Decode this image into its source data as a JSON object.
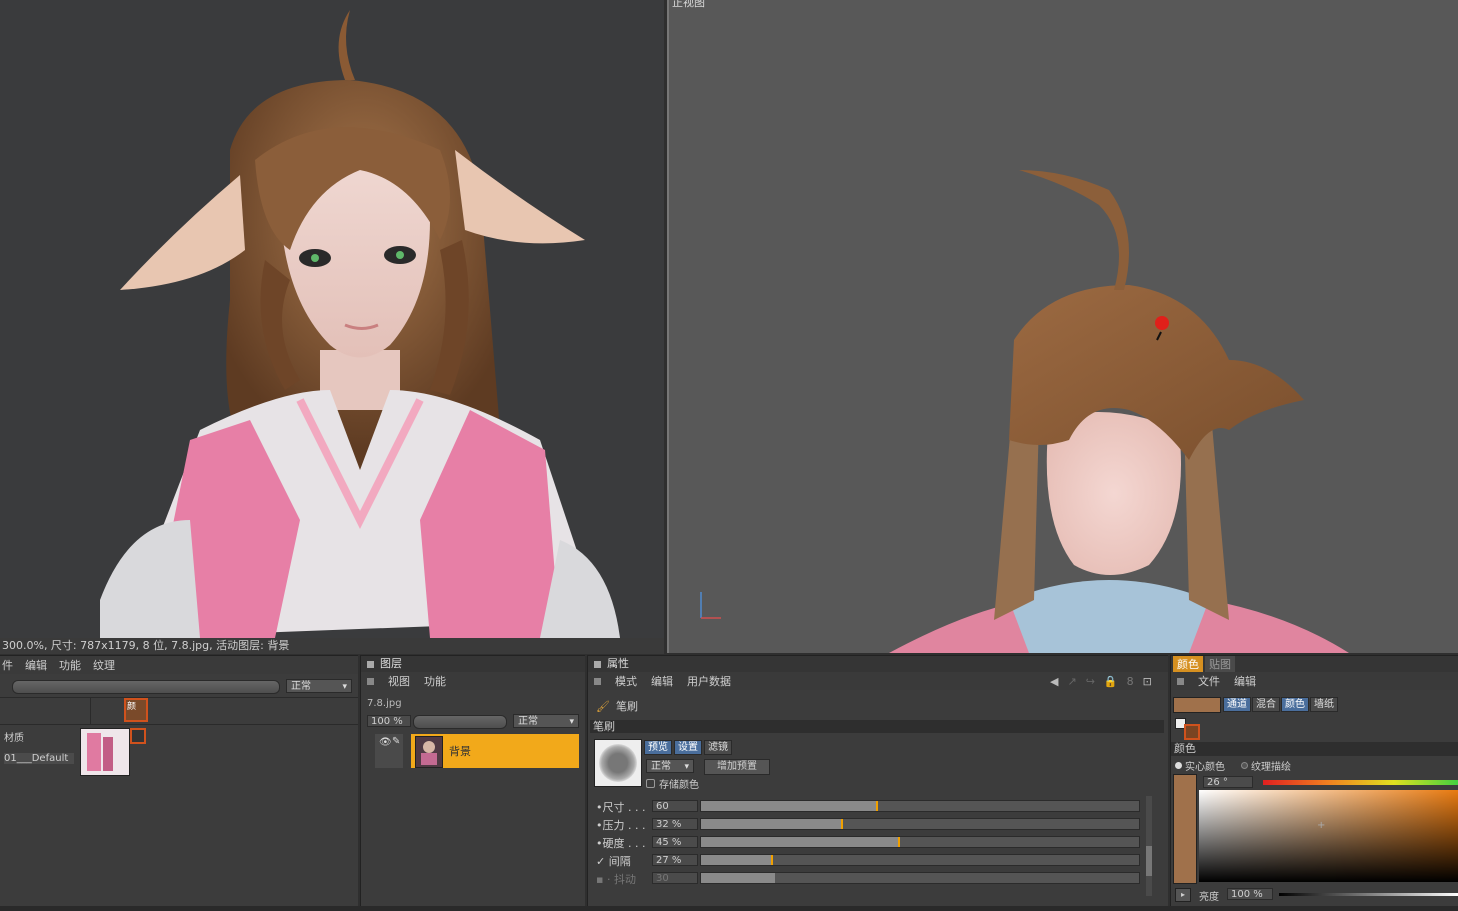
{
  "texture_view": {
    "status": "300.0%, 尺寸: 787x1179, 8 位, 7.8.jpg, 活动图层: 背景"
  },
  "model_view": {
    "title": "正视图"
  },
  "materials_panel": {
    "menu": [
      "件",
      "编辑",
      "功能",
      "纹理"
    ],
    "mode_dropdown": "正常",
    "column_label": "材质",
    "material_name": "01___Default",
    "color_channel_label": "颜"
  },
  "layers_panel": {
    "title": "图层",
    "menu": [
      "视图",
      "功能"
    ],
    "file_name": "7.8.jpg",
    "opacity": "100 %",
    "blend_mode": "正常",
    "layer_name": "背景"
  },
  "attributes_panel": {
    "title": "属性",
    "menu": [
      "模式",
      "编辑",
      "用户数据"
    ],
    "tool_name": "笔刷",
    "section_label": "笔刷",
    "preview_tabs": [
      "预览",
      "设置",
      "滤镜"
    ],
    "blend_mode": "正常",
    "add_preset_button": "增加预置",
    "save_color_label": "存储颜色",
    "params": [
      {
        "label": "尺寸 . . .",
        "value": "60",
        "fraction": 0.4,
        "dot": true,
        "enabled": true
      },
      {
        "label": "压力 . . .",
        "value": "32 %",
        "fraction": 0.32,
        "dot": true,
        "enabled": true
      },
      {
        "label": "硬度 . . .",
        "value": "45 %",
        "fraction": 0.45,
        "dot": true,
        "enabled": true
      },
      {
        "label": "间隔",
        "value": "27 %",
        "fraction": 0.16,
        "dot": false,
        "checked": true,
        "enabled": true
      },
      {
        "label": "抖动",
        "value": "30",
        "fraction": 0.17,
        "dot": false,
        "checked": false,
        "enabled": false
      }
    ]
  },
  "color_panel": {
    "tabs": [
      "颜色",
      "贴图"
    ],
    "menu": [
      "文件",
      "编辑"
    ],
    "mode_tabs": [
      "通道",
      "混合",
      "颜色",
      "墙纸"
    ],
    "section_label": "颜色",
    "radio_solid": "实心颜色",
    "radio_texture": "纹理描绘",
    "hue_value": "26 °",
    "brightness_label": "亮度",
    "brightness_value": "100 %",
    "current_color": "#a0714b"
  }
}
